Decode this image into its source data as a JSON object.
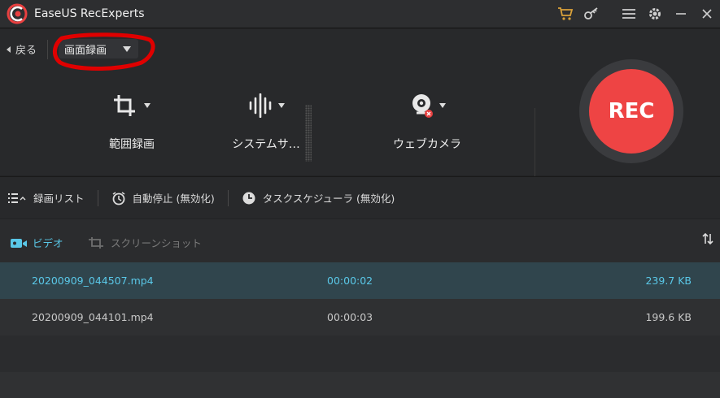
{
  "app": {
    "title": "EaseUS RecExperts"
  },
  "colors": {
    "accent": "#5ac8e8",
    "rec": "#ee4444",
    "annotation": "#e00000"
  },
  "titlebar": {
    "icons": [
      "cart-icon",
      "key-icon",
      "menu-icon",
      "gear-icon",
      "minimize-icon",
      "close-icon"
    ]
  },
  "toolbar": {
    "back_label": "戻る",
    "mode_select": "画面録画",
    "tools": {
      "region": "範囲録画",
      "audio": "システムサ…",
      "webcam": "ウェブカメラ"
    },
    "rec_label": "REC"
  },
  "listbar": {
    "list_label": "録画リスト",
    "auto_stop": "自動停止 (無効化)",
    "scheduler": "タスクスケジューラ (無効化)"
  },
  "tabs": {
    "video": "ビデオ",
    "screenshot": "スクリーンショット"
  },
  "files": [
    {
      "name": "20200909_044507.mp4",
      "duration": "00:00:02",
      "size": "239.7 KB",
      "selected": true
    },
    {
      "name": "20200909_044101.mp4",
      "duration": "00:00:03",
      "size": "199.6 KB",
      "selected": false
    }
  ]
}
